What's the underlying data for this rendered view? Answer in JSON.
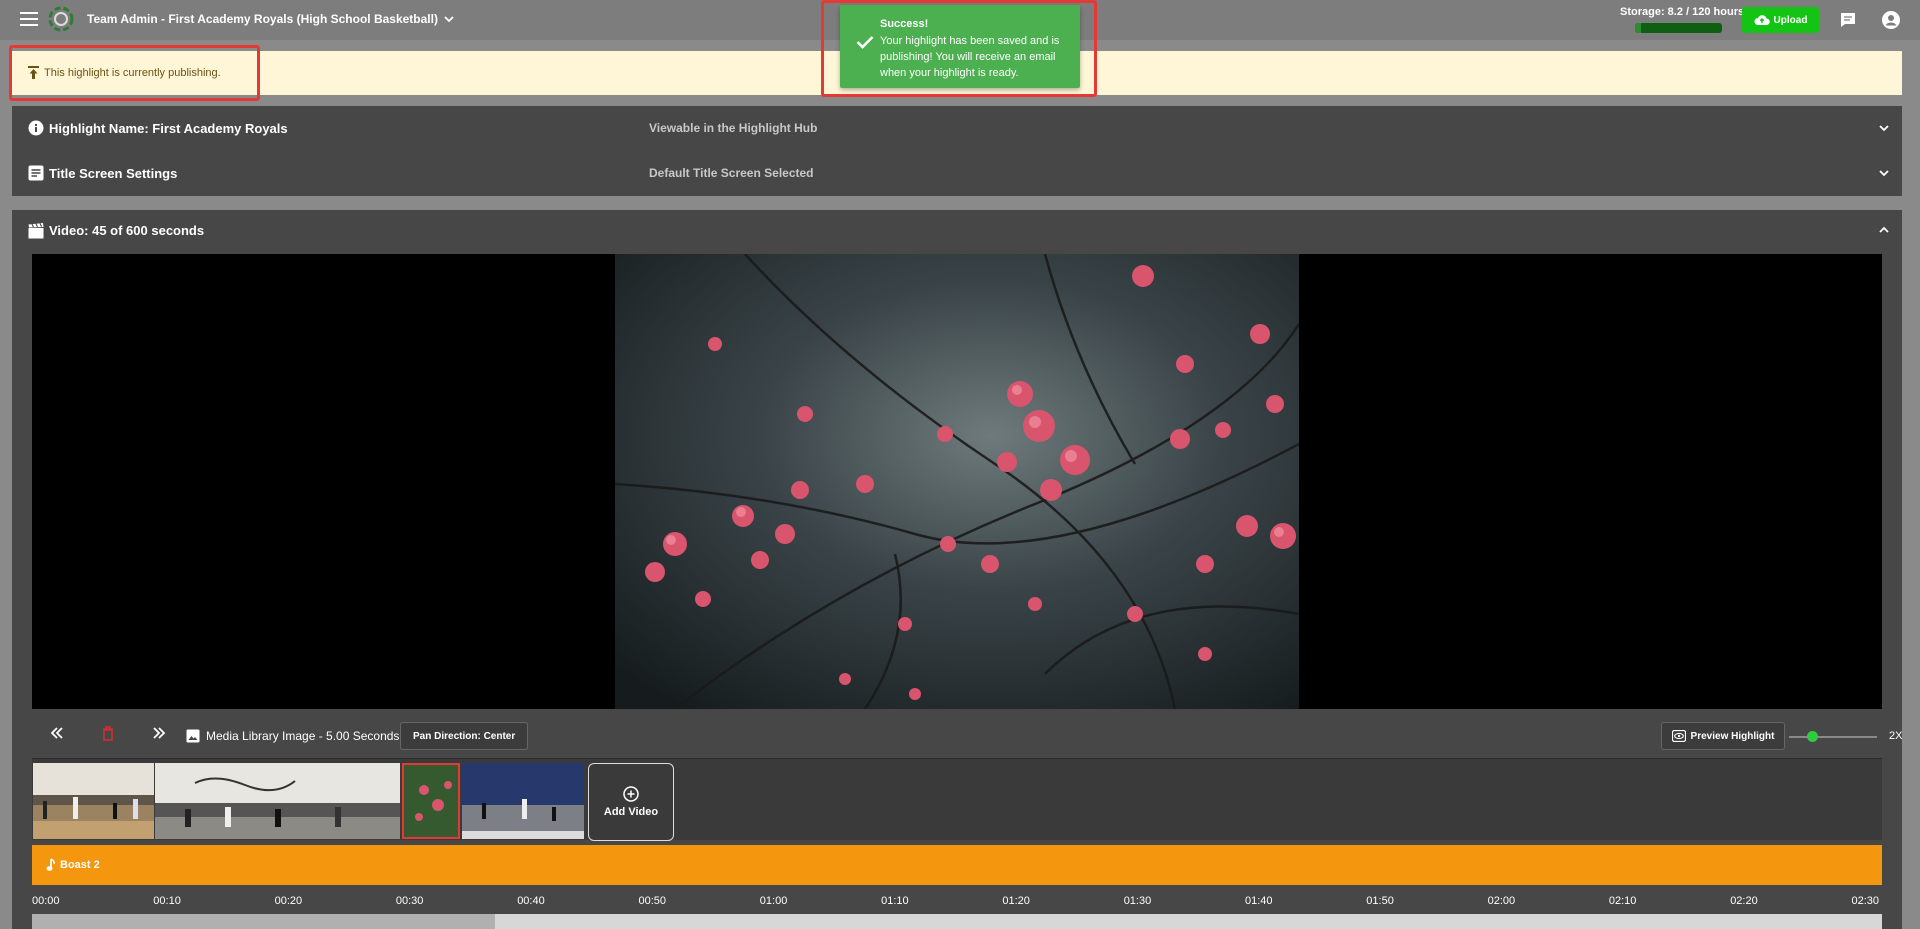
{
  "header": {
    "team_title": "Team Admin - First Academy Royals (High School Basketball)",
    "storage_text": "Storage: 8.2 / 120 hours",
    "storage_used_fraction": 0.068,
    "upload_label": "Upload"
  },
  "banner": {
    "text": "This highlight is currently publishing."
  },
  "toast": {
    "title": "Success!",
    "message": "Your highlight has been saved and is publishing! You will receive an email when your highlight is ready."
  },
  "panels": {
    "highlight_name_label": "Highlight Name: First Academy Royals",
    "highlight_name_value": "Viewable in the Highlight Hub",
    "title_screen_label": "Title Screen Settings",
    "title_screen_value": "Default Title Screen Selected",
    "video_label": "Video: 45 of 600 seconds"
  },
  "controls": {
    "media_label": "Media Library Image - 5.00 Seconds",
    "pan_label": "Pan Direction: Center",
    "preview_label": "Preview Highlight",
    "zoom_label": "2X"
  },
  "timeline": {
    "add_video_label": "Add Video"
  },
  "music": {
    "track_label": "Boast 2"
  },
  "ruler": {
    "ticks": [
      "00:00",
      "00:10",
      "00:20",
      "00:30",
      "00:40",
      "00:50",
      "01:00",
      "01:10",
      "01:20",
      "01:30",
      "01:40",
      "01:50",
      "02:00",
      "02:10",
      "02:20",
      "02:30"
    ],
    "progress_fraction": 0.25
  },
  "colors": {
    "accent_green": "#14c414",
    "toast_green": "#4caf50",
    "music_orange": "#f5960f",
    "highlight_red": "#e53935"
  }
}
